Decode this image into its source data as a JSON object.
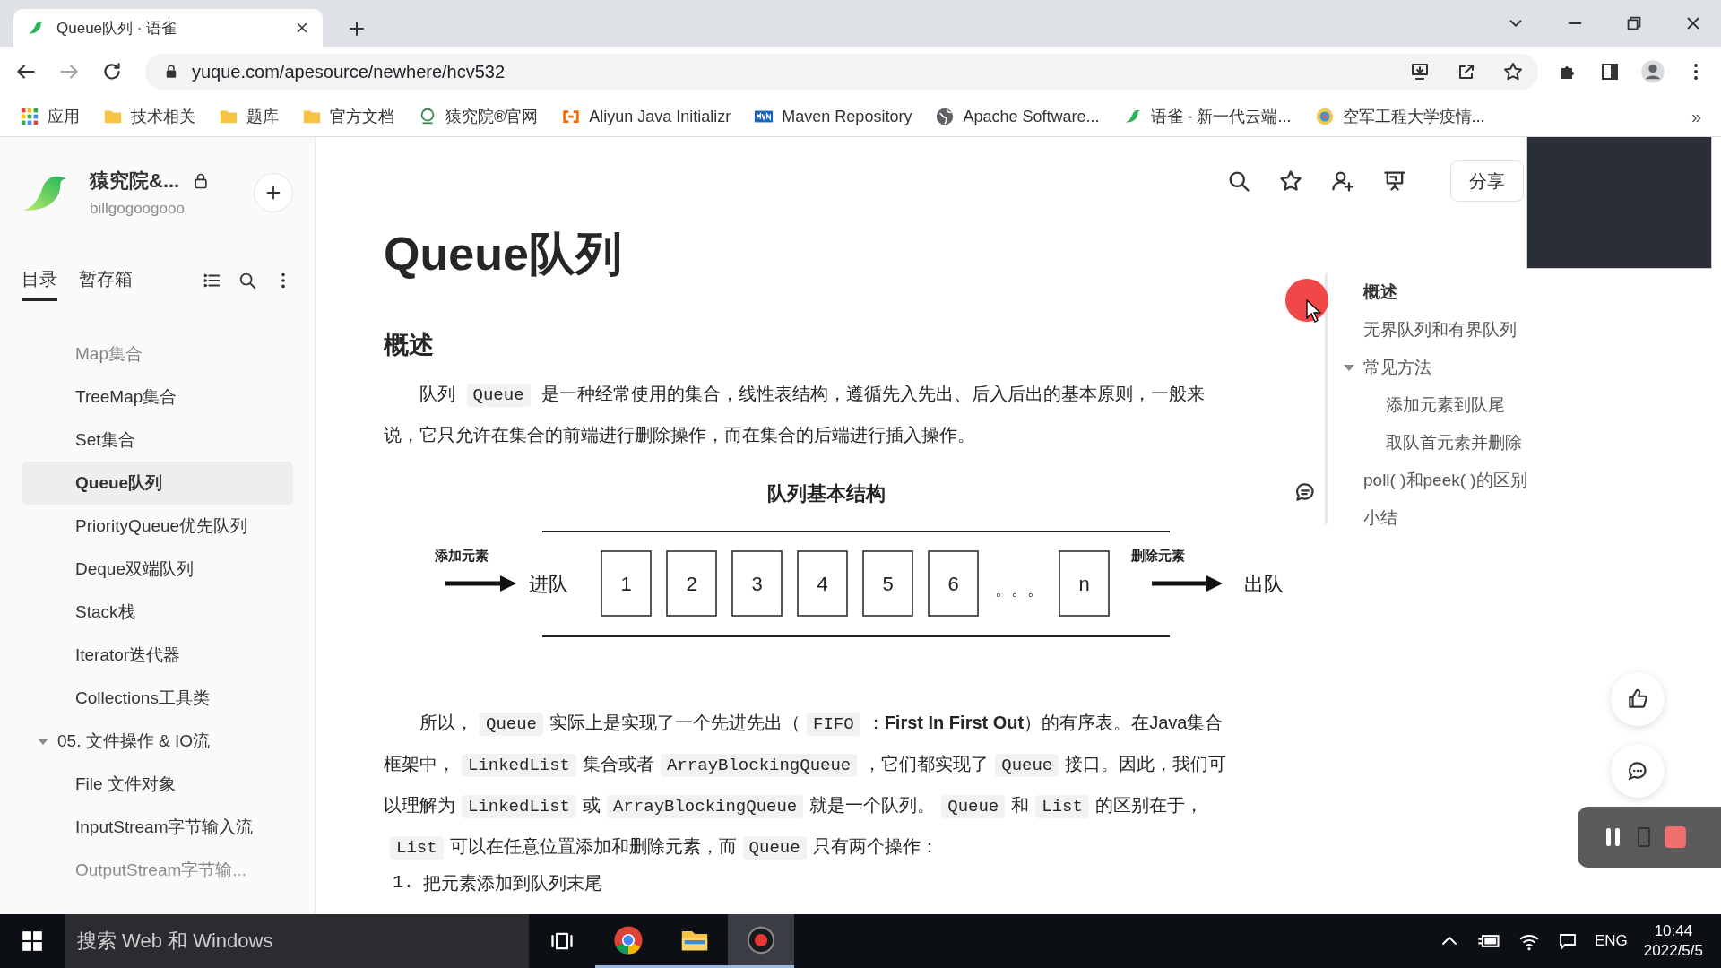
{
  "browser": {
    "tab": {
      "title": "Queue队列 · 语雀"
    },
    "url": "yuque.com/apesource/newhere/hcv532",
    "bookmarks": [
      {
        "kind": "apps",
        "label": "应用"
      },
      {
        "kind": "folder",
        "label": "技术相关"
      },
      {
        "kind": "folder",
        "label": "题库"
      },
      {
        "kind": "folder",
        "label": "官方文档"
      },
      {
        "kind": "site",
        "label": "猿究院®官网"
      },
      {
        "kind": "aliyun",
        "label": "Aliyun Java Initializr"
      },
      {
        "kind": "maven",
        "label": "Maven Repository"
      },
      {
        "kind": "globe",
        "label": "Apache Software..."
      },
      {
        "kind": "yuque",
        "label": "语雀 - 新一代云端..."
      },
      {
        "kind": "emblem",
        "label": "空军工程大学疫情..."
      }
    ],
    "more_bookmarks": "»"
  },
  "sidebar": {
    "space_name": "猿究院&...",
    "user": "billgogoogooo",
    "tabs": [
      {
        "label": "目录",
        "selected": true
      },
      {
        "label": "暂存箱",
        "selected": false
      }
    ],
    "tree": [
      {
        "children": [
          {
            "label": "Map集合",
            "selected": false
          },
          {
            "label": "TreeMap集合",
            "selected": false
          },
          {
            "label": "Set集合",
            "selected": false
          },
          {
            "label": "Queue队列",
            "selected": true
          },
          {
            "label": "PriorityQueue优先队列",
            "selected": false
          },
          {
            "label": "Deque双端队列",
            "selected": false
          },
          {
            "label": "Stack栈",
            "selected": false
          },
          {
            "label": "Iterator迭代器",
            "selected": false
          },
          {
            "label": "Collections工具类",
            "selected": false
          }
        ]
      },
      {
        "label": "05. 文件操作 & IO流",
        "selected": false,
        "expanded": true,
        "children": [
          {
            "label": "File 文件对象",
            "selected": false
          },
          {
            "label": "InputStream字节输入流",
            "selected": false
          },
          {
            "label": "OutputStream字节输...",
            "selected": false
          }
        ]
      }
    ]
  },
  "toolbar": {
    "share": "分享"
  },
  "document": {
    "title": "Queue队列",
    "blocks": [
      {
        "kind": "h2",
        "text": "概述"
      },
      {
        "kind": "p",
        "segments": [
          {
            "kind": "text",
            "text": "队列 "
          },
          {
            "kind": "code",
            "text": "Queue"
          },
          {
            "kind": "text",
            "text": " 是一种经常使用的集合，线性表结构，遵循先入先出、后入后出的基本原则，一般来说，它只允许在集合的前端进行删除操作，而在集合的后端进行插入操作。"
          }
        ]
      },
      {
        "kind": "diagram",
        "title": "队列基本结构",
        "in_note": "添加元素",
        "in_label": "进队",
        "out_note": "删除元素",
        "out_label": "出队",
        "cells": [
          {
            "kind": "box",
            "text": "1"
          },
          {
            "kind": "box",
            "text": "2"
          },
          {
            "kind": "box",
            "text": "3"
          },
          {
            "kind": "box",
            "text": "4"
          },
          {
            "kind": "box",
            "text": "5"
          },
          {
            "kind": "box",
            "text": "6"
          },
          {
            "kind": "gap",
            "text": "。。。"
          },
          {
            "kind": "box",
            "text": "n"
          }
        ]
      },
      {
        "kind": "p",
        "segments": [
          {
            "kind": "text",
            "text": "所以，"
          },
          {
            "kind": "code",
            "text": "Queue"
          },
          {
            "kind": "text",
            "text": "实际上是实现了一个先进先出（"
          },
          {
            "kind": "code",
            "text": "FIFO"
          },
          {
            "kind": "text",
            "text": "："
          },
          {
            "kind": "bold",
            "text": "First In First Out"
          },
          {
            "kind": "text",
            "text": "）的有序表。在Java集合框架中，"
          },
          {
            "kind": "code",
            "text": "LinkedList"
          },
          {
            "kind": "text",
            "text": "集合或者"
          },
          {
            "kind": "code",
            "text": "ArrayBlockingQueue"
          },
          {
            "kind": "text",
            "text": "，它们都实现了"
          },
          {
            "kind": "code",
            "text": "Queue"
          },
          {
            "kind": "text",
            "text": "接口。因此，我们可以理解为"
          },
          {
            "kind": "code",
            "text": "LinkedList"
          },
          {
            "kind": "text",
            "text": "或"
          },
          {
            "kind": "code",
            "text": "ArrayBlockingQueue"
          },
          {
            "kind": "text",
            "text": "就是一个队列。"
          },
          {
            "kind": "code",
            "text": "Queue"
          },
          {
            "kind": "text",
            "text": "和"
          },
          {
            "kind": "code",
            "text": "List"
          },
          {
            "kind": "text",
            "text": "的区别在于，"
          },
          {
            "kind": "code",
            "text": "List"
          },
          {
            "kind": "text",
            "text": "可以在任意位置添加和删除元素，而"
          },
          {
            "kind": "code",
            "text": "Queue"
          },
          {
            "kind": "text",
            "text": "只有两个操作："
          }
        ]
      },
      {
        "kind": "li",
        "number": "1.",
        "text": "把元素添加到队列末尾"
      }
    ]
  },
  "toc": [
    {
      "label": "概述",
      "selected": true
    },
    {
      "label": "无界队列和有界队列",
      "selected": false
    },
    {
      "label": "常见方法",
      "selected": false,
      "expanded": true,
      "children": [
        {
          "label": "添加元素到队尾",
          "selected": false
        },
        {
          "label": "取队首元素并删除",
          "selected": false
        }
      ]
    },
    {
      "label": "poll( )和peek( )的区别",
      "selected": false
    },
    {
      "label": "小结",
      "selected": false
    }
  ],
  "taskbar": {
    "search": {
      "placeholder": "搜索 Web 和 Windows"
    },
    "apps": [
      {
        "kind": "chrome",
        "selected": false
      },
      {
        "kind": "explorer",
        "selected": false
      },
      {
        "kind": "recorder",
        "selected": true
      }
    ],
    "language": "ENG",
    "time": "10:44",
    "date": "2022/5/5"
  }
}
